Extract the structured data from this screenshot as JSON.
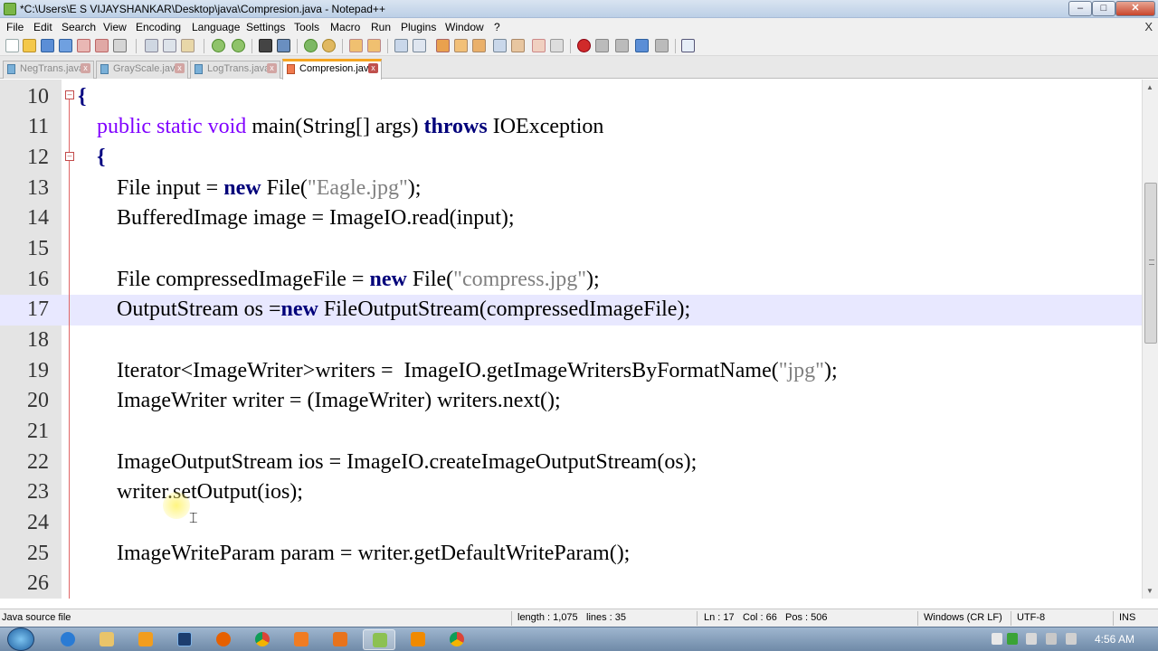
{
  "window": {
    "title": "*C:\\Users\\E S VIJAYSHANKAR\\Desktop\\java\\Compresion.java - Notepad++",
    "minimize_label": "–",
    "maximize_label": "□",
    "close_label": "✕"
  },
  "menu": {
    "items": [
      "File",
      "Edit",
      "Search",
      "View",
      "Encoding",
      "Language",
      "Settings",
      "Tools",
      "Macro",
      "Run",
      "Plugins",
      "Window",
      "?"
    ],
    "doc_close": "X"
  },
  "toolbar": {
    "icons": [
      "new-file-icon",
      "open-file-icon",
      "save-icon",
      "save-all-icon",
      "close-icon",
      "close-all-icon",
      "print-icon",
      "cut-icon",
      "copy-icon",
      "paste-icon",
      "undo-icon",
      "redo-icon",
      "find-icon",
      "replace-icon",
      "zoom-in-icon",
      "zoom-out-icon",
      "sync-vertical-icon",
      "sync-horizontal-icon",
      "word-wrap-icon",
      "show-all-chars-icon",
      "indent-guide-icon",
      "doc-map-icon",
      "function-list-icon",
      "folder-workspace-icon",
      "monitoring-icon",
      "record-macro-icon",
      "stop-record-icon",
      "play-macro-icon",
      "run-macro-multiple-icon",
      "save-macro-icon",
      "launch-icon"
    ]
  },
  "tabs": [
    {
      "label": "NegTrans.java",
      "active": false
    },
    {
      "label": "GrayScale.java",
      "active": false
    },
    {
      "label": "LogTrans.java",
      "active": false
    },
    {
      "label": "Compresion.java",
      "active": true
    }
  ],
  "editor": {
    "current_line": 17,
    "lines": [
      {
        "n": "10"
      },
      {
        "n": "11"
      },
      {
        "n": "12"
      },
      {
        "n": "13"
      },
      {
        "n": "14"
      },
      {
        "n": "15"
      },
      {
        "n": "16"
      },
      {
        "n": "17"
      },
      {
        "n": "18"
      },
      {
        "n": "19"
      },
      {
        "n": "20"
      },
      {
        "n": "21"
      },
      {
        "n": "22"
      },
      {
        "n": "23"
      },
      {
        "n": "24"
      },
      {
        "n": "25"
      },
      {
        "n": "26"
      }
    ],
    "code": {
      "l10": "{",
      "l11_kw": "public static void",
      "l11_main": " main(String[] args) ",
      "l11_throws": "throws",
      "l11_exc": " IOException",
      "l12": "{",
      "l13_a": "File input = ",
      "l13_new": "new",
      "l13_b": " File(",
      "l13_str": "\"Eagle.jpg\"",
      "l13_c": ");",
      "l14": "BufferedImage image = ImageIO.read(input);",
      "l16_a": "File compressedImageFile = ",
      "l16_new": "new",
      "l16_b": " File(",
      "l16_str": "\"compress.jpg\"",
      "l16_c": ");",
      "l17_a": "OutputStream os =",
      "l17_new": "new",
      "l17_b": " FileOutputStream(compressedImageFile);",
      "l19_a": "Iterator<ImageWriter>writers =  ImageIO.getImageWritersByFormatName(",
      "l19_str": "\"jpg\"",
      "l19_c": ");",
      "l20": "ImageWriter writer = (ImageWriter) writers.next();",
      "l22": "ImageOutputStream ios = ImageIO.createImageOutputStream(os);",
      "l23": "writer.setOutput(ios);",
      "l25": "ImageWriteParam param = writer.getDefaultWriteParam();"
    }
  },
  "statusbar": {
    "file_type": "Java source file",
    "length": "length : 1,075",
    "lines": "lines : 35",
    "ln": "Ln : 17",
    "col": "Col : 66",
    "pos": "Pos : 506",
    "eol": "Windows (CR LF)",
    "encoding": "UTF-8",
    "mode": "INS"
  },
  "taskbar": {
    "apps": [
      "edge-icon",
      "explorer-icon",
      "media-player-icon",
      "photoshop-icon",
      "firefox-icon",
      "chrome-icon",
      "app-orange-icon",
      "app-orange2-icon",
      "notepadpp-icon",
      "vlc-icon",
      "chrome2-icon"
    ],
    "active_app": "notepadpp-icon",
    "clock": "4:56 AM"
  }
}
